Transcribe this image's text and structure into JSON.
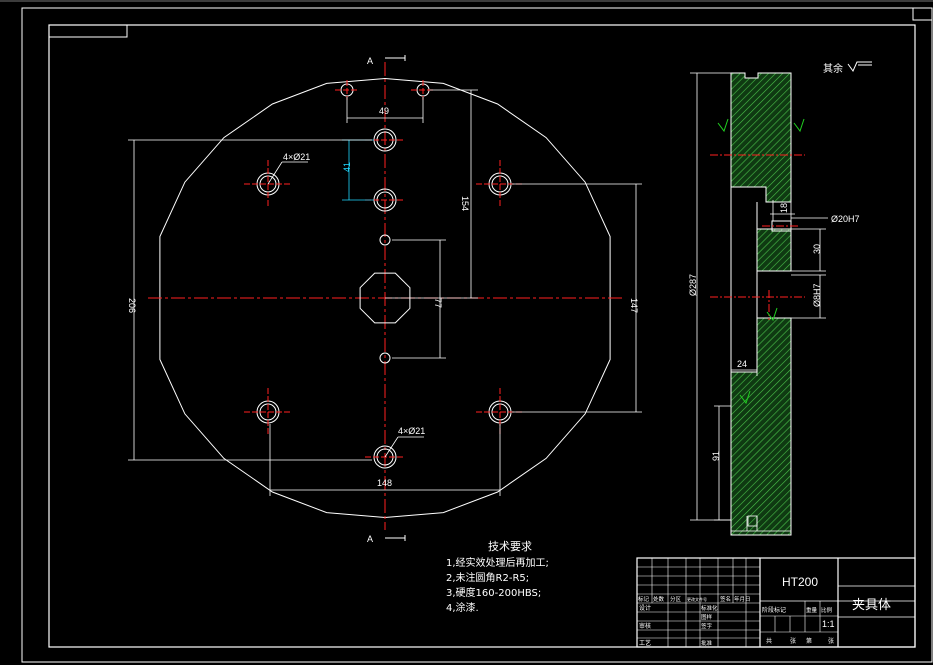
{
  "section_label_top": "A",
  "section_label_bottom": "A",
  "surface_note": "其余",
  "front_view": {
    "dim_49": "49",
    "dim_41": "41",
    "hole_note_top": "4×Ø21",
    "hole_note_bottom": "4×Ø21",
    "dim_154": "154",
    "dim_77": "77",
    "dim_206": "206",
    "dim_147": "147",
    "dim_148": "148"
  },
  "side_view": {
    "dim_18": "18",
    "dim_20h7": "Ø20H7",
    "dim_30": "30",
    "dim_287": "Ø287",
    "dim_8h7": "Ø8H7",
    "dim_24": "24",
    "dim_91": "91"
  },
  "tech_requirements": {
    "title": "技术要求",
    "lines": [
      "1,经实效处理后再加工;",
      "2,未注圆角R2-R5;",
      "3,硬度160-200HBS;",
      "4,涂漆."
    ]
  },
  "title_block": {
    "material": "HT200",
    "part_name": "夹具体",
    "scale": "1:1",
    "rev_headers": [
      "标记",
      "处数",
      "分区",
      "更改文件号",
      "签名",
      "年月日"
    ],
    "row_labels": [
      "设计",
      "审核",
      "工艺"
    ],
    "std_labels": [
      "标准化",
      "批准"
    ],
    "stage_headers": [
      "阶段标记",
      "重量",
      "比例"
    ],
    "sheet_labels": [
      "共",
      "张",
      "第",
      "张"
    ],
    "cell_labels": [
      "图样",
      "签字"
    ]
  }
}
